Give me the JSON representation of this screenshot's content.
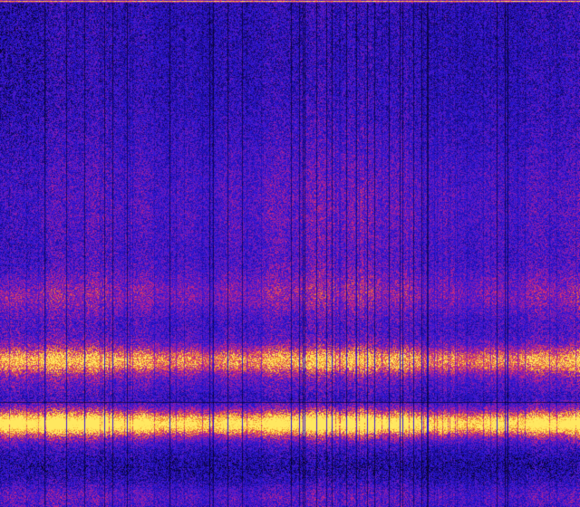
{
  "image": {
    "kind": "spectrogram",
    "colormap": "plasma-like",
    "colors": {
      "background": "#000000",
      "deep_blue": "#1a0a8c",
      "blue": "#2a18d8",
      "purple": "#7a1bb8",
      "magenta": "#d0287a",
      "orange": "#f08a2a",
      "yellow": "#ffe860"
    },
    "features": [
      {
        "name": "bright-band-low",
        "relative_level": 0.84
      },
      {
        "name": "bright-band-mid",
        "relative_level": 0.72
      },
      {
        "name": "diffuse-band-upper",
        "relative_level": 0.58
      },
      {
        "name": "top-edge-line",
        "relative_level": 0.995
      },
      {
        "name": "dark-vertical-stripes",
        "relative_level": 0.5
      }
    ]
  }
}
